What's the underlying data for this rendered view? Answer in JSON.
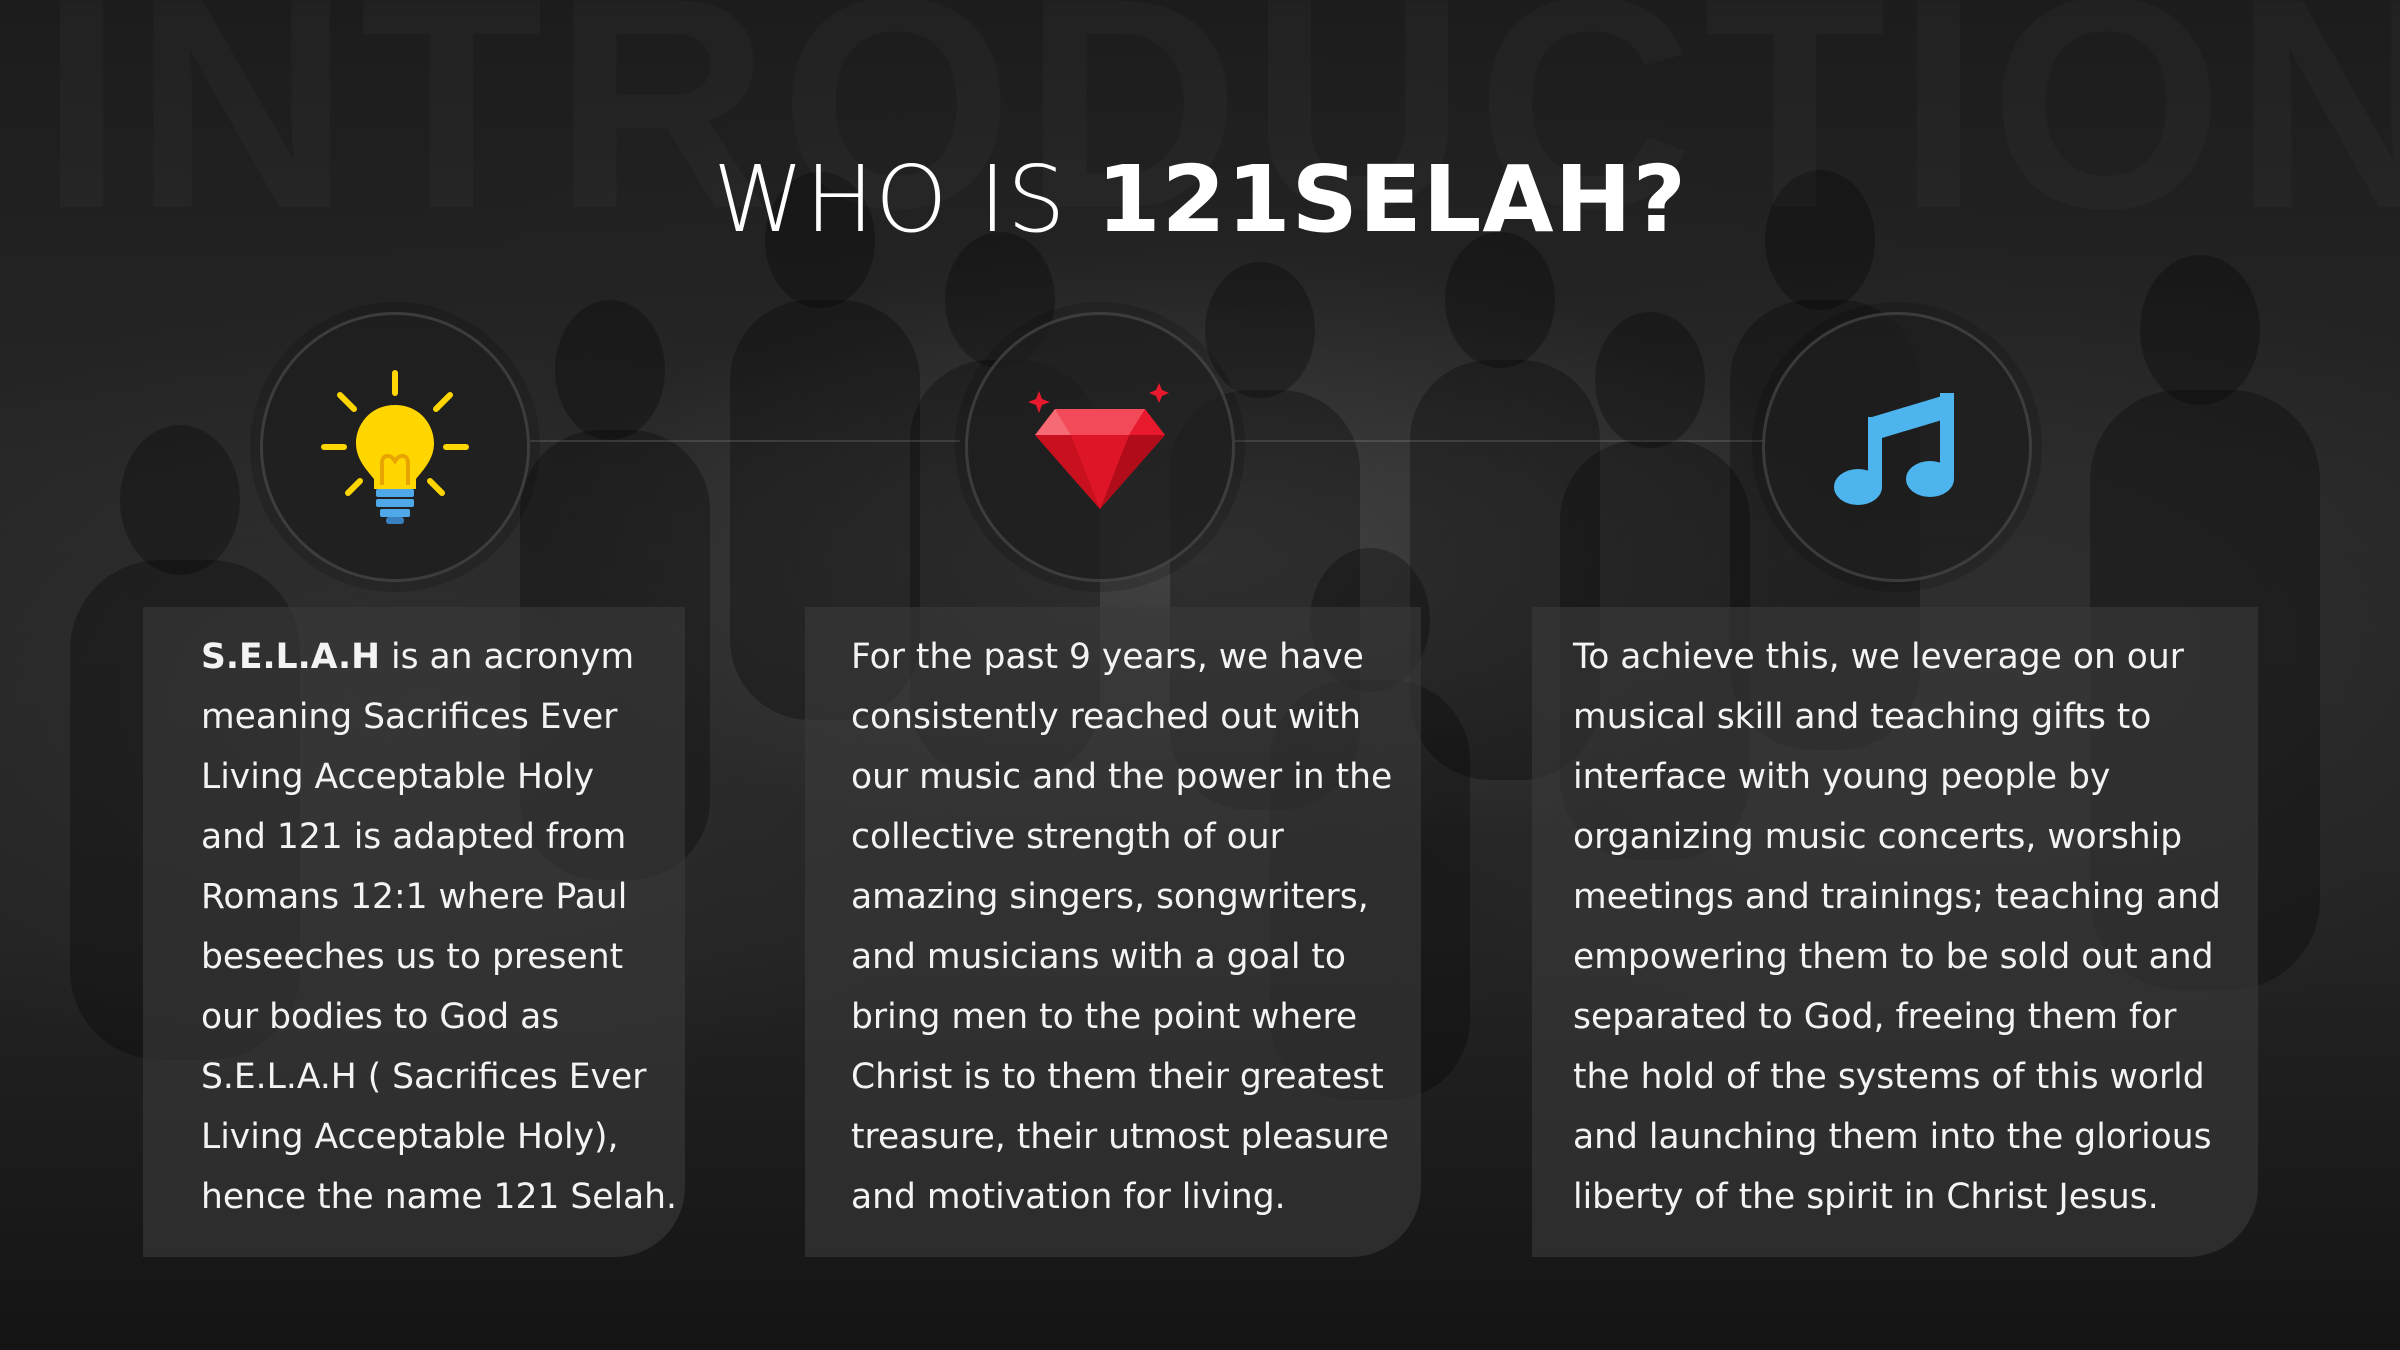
{
  "title": {
    "light": "WHO IS ",
    "bold": "121SELAH?"
  },
  "icons": [
    {
      "name": "light-bulb-icon"
    },
    {
      "name": "gem-icon"
    },
    {
      "name": "music-note-icon"
    }
  ],
  "colors": {
    "bulb": "#FFD600",
    "bulb_base": "#4FA9E8",
    "gem": "#E8192C",
    "music": "#4DB4EE",
    "card_bg": "#3A3A3A"
  },
  "cards": [
    {
      "bold_lead": "S.E.L.A.H",
      "text": " is an acronym\nmeaning Sacrifices Ever\nLiving Acceptable Holy\nand 121 is adapted from\nRomans 12:1 where Paul\nbeseeches us to present\nour bodies to God as\nS.E.L.A.H ( Sacrifices Ever\nLiving Acceptable Holy),\nhence the name 121 Selah."
    },
    {
      "text": "For the past 9 years, we have\nconsistently reached out with\nour music and the power in the\ncollective strength of our\namazing singers, songwriters,\nand musicians  with a goal to\nbring men to the point where\nChrist is to them their greatest\ntreasure, their utmost pleasure\nand motivation for living."
    },
    {
      "text": "To achieve this, we leverage on our\nmusical skill and teaching gifts to\ninterface with young people by\norganizing music concerts, worship\nmeetings and trainings; teaching and\nempowering them to be sold out and\nseparated to God, freeing them for\nthe hold of the systems of this world\nand launching them into the glorious\nliberty of the spirit in Christ Jesus."
    }
  ]
}
